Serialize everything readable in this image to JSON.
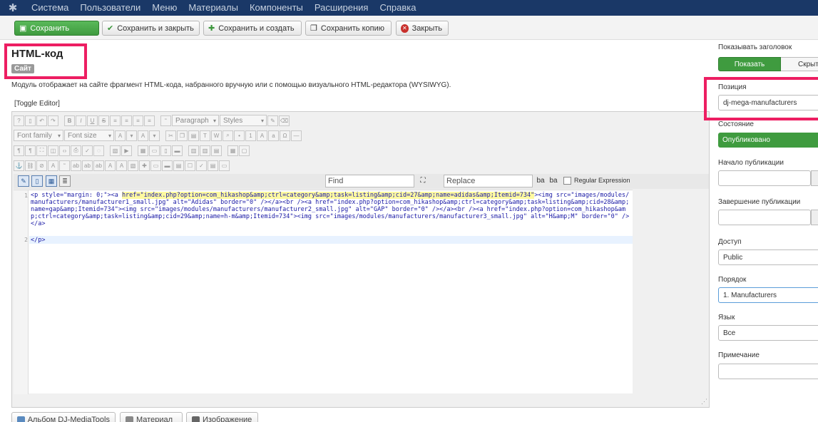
{
  "nav": {
    "items": [
      "Система",
      "Пользователи",
      "Меню",
      "Материалы",
      "Компоненты",
      "Расширения",
      "Справка"
    ]
  },
  "toolbar": {
    "save": "Сохранить",
    "save_close": "Сохранить и закрыть",
    "save_new": "Сохранить и создать",
    "save_copy": "Сохранить копию",
    "close": "Закрыть"
  },
  "header": {
    "title": "HTML-код",
    "badge": "Сайт",
    "description": "Модуль отображает на сайте фрагмент HTML-кода, набранного вручную или с помощью визуального HTML-редактора (WYSIWYG).",
    "toggle_editor": "[Toggle Editor]"
  },
  "editor": {
    "paragraph_select": "Paragraph",
    "styles_select": "Styles",
    "font_family_select": "Font family",
    "font_size_select": "Font size",
    "find_placeholder": "Find",
    "replace_placeholder": "Replace",
    "regex_label": "Regular Expression",
    "line_numbers": [
      "1",
      "2"
    ],
    "code_line1_pre": "<p style=\"margin: 0;\"><a ",
    "code_line1_highlight": "href=\"index.php?option=com_hikashop&amp;ctrl=category&amp;task=listing&amp;cid=27&amp;name=adidas&amp;Itemid=734\"",
    "code_line1_post": "><img src=\"images/modules/manufacturers/manufacturer1_small.jpg\" alt=\"Adidas\" border=\"0\" /></a><br /><a href=\"index.php?option=com_hikashop&amp;ctrl=category&amp;task=listing&amp;cid=28&amp;name=gap&amp;Itemid=734\"><img src=\"images/modules/manufacturers/manufacturer2_small.jpg\" alt=\"GAP\" border=\"0\" /></a><br /><a href=\"index.php?option=com_hikashop&amp;ctrl=category&amp;task=listing&amp;cid=29&amp;name=h-m&amp;Itemid=734\"><img src=\"images/modules/manufacturers/manufacturer3_small.jpg\" alt=\"H&amp;M\" border=\"0\" /></a>",
    "code_line2": "</p>"
  },
  "bottom_buttons": {
    "album": "Альбом DJ-MediaTools",
    "article": "Материал",
    "image": "Изображение"
  },
  "sidebar": {
    "show_title_label": "Показывать заголовок",
    "show_label": "Показать",
    "hide_label": "Скрыть",
    "position_label": "Позиция",
    "position_value": "dj-mega-manufacturers",
    "state_label": "Состояние",
    "state_value": "Опубликовано",
    "publish_up_label": "Начало публикации",
    "publish_down_label": "Завершение публикации",
    "access_label": "Доступ",
    "access_value": "Public",
    "ordering_label": "Порядок",
    "ordering_value": "1. Manufacturers",
    "language_label": "Язык",
    "language_value": "Все",
    "note_label": "Примечание"
  },
  "colors": {
    "nav_bg": "#1a3867",
    "accent_green": "#3f9b3f",
    "highlight_box": "#ed1e62",
    "danger": "#c8302c"
  }
}
